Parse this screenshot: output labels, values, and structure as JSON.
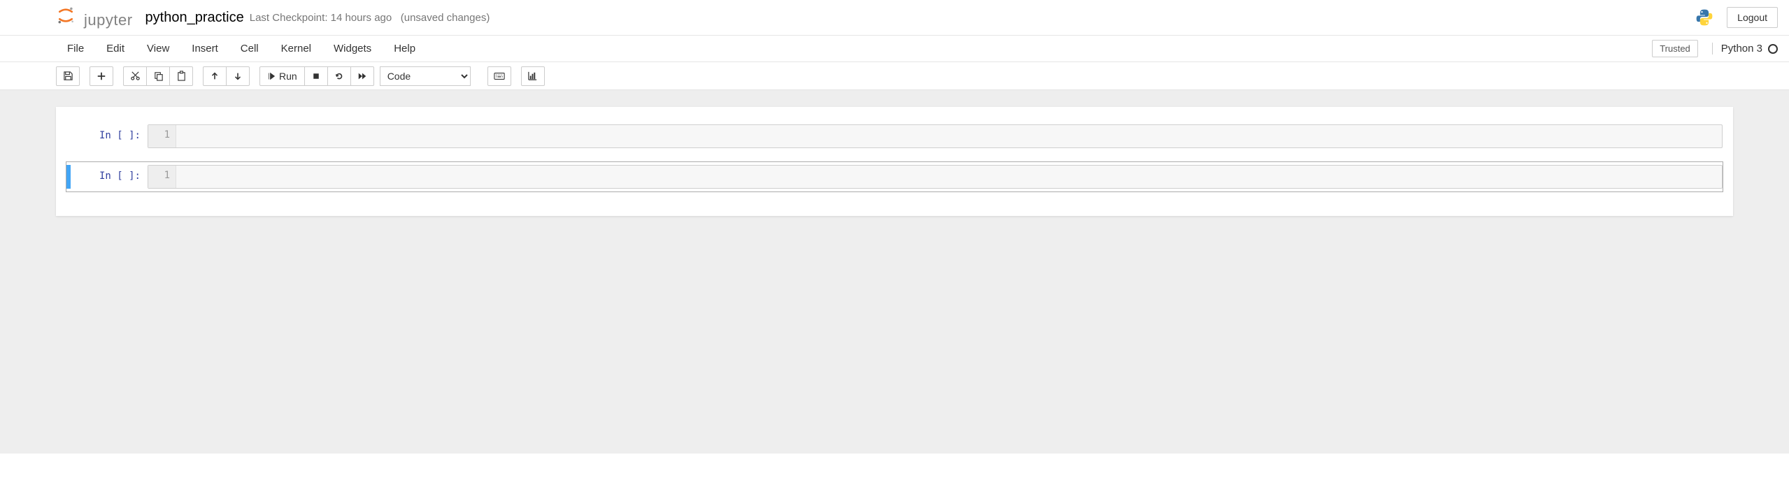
{
  "header": {
    "logo_text": "jupyter",
    "notebook_name": "python_practice",
    "checkpoint": "Last Checkpoint: 14 hours ago",
    "save_status": "(unsaved changes)",
    "logout": "Logout"
  },
  "menubar": {
    "items": [
      "File",
      "Edit",
      "View",
      "Insert",
      "Cell",
      "Kernel",
      "Widgets",
      "Help"
    ],
    "trusted": "Trusted",
    "kernel": "Python 3"
  },
  "toolbar": {
    "run_label": "Run",
    "cell_type": "Code"
  },
  "cells": [
    {
      "prompt": "In [ ]:",
      "gutter": "1",
      "content": "",
      "selected": false
    },
    {
      "prompt": "In [ ]:",
      "gutter": "1",
      "content": "",
      "selected": true
    }
  ]
}
